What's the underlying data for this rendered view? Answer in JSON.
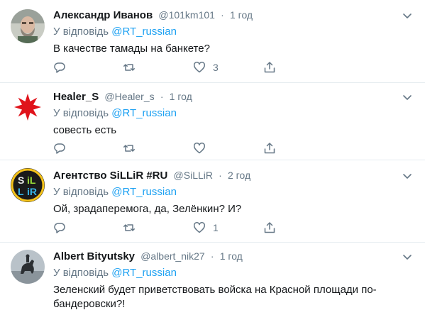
{
  "tweets": [
    {
      "display_name": "Александр Иванов",
      "handle": "@101km101",
      "separator": "·",
      "time": "1 год",
      "reply_prefix": "У відповідь",
      "reply_to": "@RT_russian",
      "text": "В качестве тамады на банкете?",
      "reply_count": "",
      "retweet_count": "",
      "like_count": "3",
      "avatar_icon": "bearded-man-photo-avatar"
    },
    {
      "display_name": "Healer_S",
      "handle": "@Healer_s",
      "separator": "·",
      "time": "1 год",
      "reply_prefix": "У відповідь",
      "reply_to": "@RT_russian",
      "text": "совесть есть",
      "reply_count": "",
      "retweet_count": "",
      "like_count": "",
      "avatar_icon": "red-star-avatar"
    },
    {
      "display_name": "Агентство SiLLiR #RU",
      "handle": "@SiLLiR",
      "separator": "·",
      "time": "2 год",
      "reply_prefix": "У відповідь",
      "reply_to": "@RT_russian",
      "text": "Ой, зрадаперемога, да, Зелёнкин? И?",
      "reply_count": "",
      "retweet_count": "",
      "like_count": "1",
      "avatar_icon": "sillir-logo-avatar"
    },
    {
      "display_name": "Albert Bityutsky",
      "handle": "@albert_nik27",
      "separator": "·",
      "time": "1 год",
      "reply_prefix": "У відповідь",
      "reply_to": "@RT_russian",
      "text": "Зеленский будет приветствовать войска на Красной площади по-бандеровски?!",
      "avatar_icon": "equestrian-statue-photo-avatar"
    }
  ],
  "colors": {
    "link": "#1da1f2",
    "secondary_text": "#657786",
    "primary_text": "#14171a",
    "divider": "#e6ecf0",
    "icon": "#657786"
  }
}
